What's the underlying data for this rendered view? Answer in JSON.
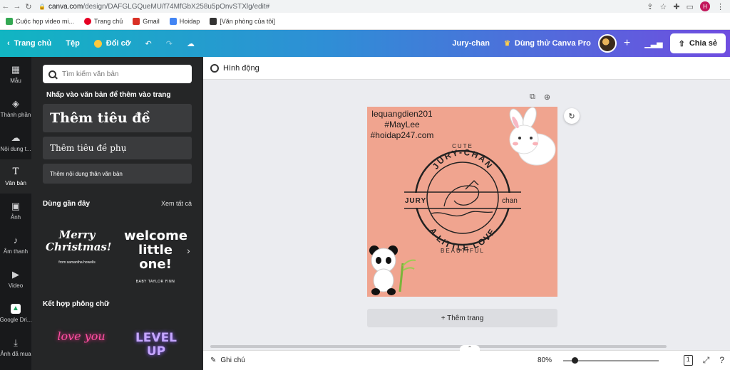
{
  "browser": {
    "url_domain": "canva.com",
    "url_path": "/design/DAFGLGQueMU/f74MfGbX258u5pOnvSTXlg/edit#",
    "profile_initial": "H"
  },
  "bookmarks": [
    {
      "label": "Cuộc họp video mi...",
      "color": "#34a853"
    },
    {
      "label": "Trang chủ",
      "color": "#e60023"
    },
    {
      "label": "Gmail",
      "color": "#d93025"
    },
    {
      "label": "Hoidap",
      "color": "#4285f4"
    },
    {
      "label": "[Văn phòng của tôi]",
      "color": "#333333"
    }
  ],
  "topbar": {
    "home": "Trang chủ",
    "file": "Tệp",
    "resize": "Đổi cỡ",
    "team": "Jury-chan",
    "try_pro": "Dùng thử Canva Pro",
    "share": "Chia sẻ"
  },
  "rail": [
    {
      "label": "Mẫu",
      "icon": "template-icon"
    },
    {
      "label": "Thành phần",
      "icon": "elements-icon"
    },
    {
      "label": "Nội dung t...",
      "icon": "upload-icon"
    },
    {
      "label": "Văn bản",
      "icon": "text-icon"
    },
    {
      "label": "Ảnh",
      "icon": "photo-icon"
    },
    {
      "label": "Âm thanh",
      "icon": "music-icon"
    },
    {
      "label": "Video",
      "icon": "video-icon"
    },
    {
      "label": "Google Dri...",
      "icon": "google-drive-icon"
    },
    {
      "label": "Ảnh đã mua",
      "icon": "download-icon"
    }
  ],
  "panel": {
    "search_placeholder": "Tìm kiếm văn bản",
    "hint": "Nhấp vào văn bản để thêm vào trang",
    "heading": "Thêm tiêu đề",
    "subheading": "Thêm tiêu đề phụ",
    "body": "Thêm nội dung thân văn bản",
    "recent_title": "Dùng gần đây",
    "see_all": "Xem tất cả",
    "samples": {
      "merry": "Merry Christmas!",
      "merry_sub": "from samantha howells",
      "welcome": "welcome little one!",
      "welcome_sub": "BABY TAYLOR FINN",
      "love": "love you",
      "levelup": "LEVEL UP"
    },
    "combo_title": "Kết hợp phông chữ"
  },
  "editor": {
    "animate": "Hình động",
    "add_page": "+ Thêm trang",
    "page_text": [
      "lequangdien201",
      "#MayLee",
      "#hoidap247.com"
    ],
    "logo": {
      "top": "CUTE",
      "arc_top": "JURY-CHAN",
      "left": "JURY",
      "right": "chan",
      "arc_bottom": "A LITTLE LOVE",
      "bottom": "BEAUTIFUL"
    },
    "page_bg": "#f0a48f"
  },
  "bottombar": {
    "notes": "Ghi chú",
    "zoom": "80%",
    "zoom_level": 80,
    "page_count": "1"
  }
}
